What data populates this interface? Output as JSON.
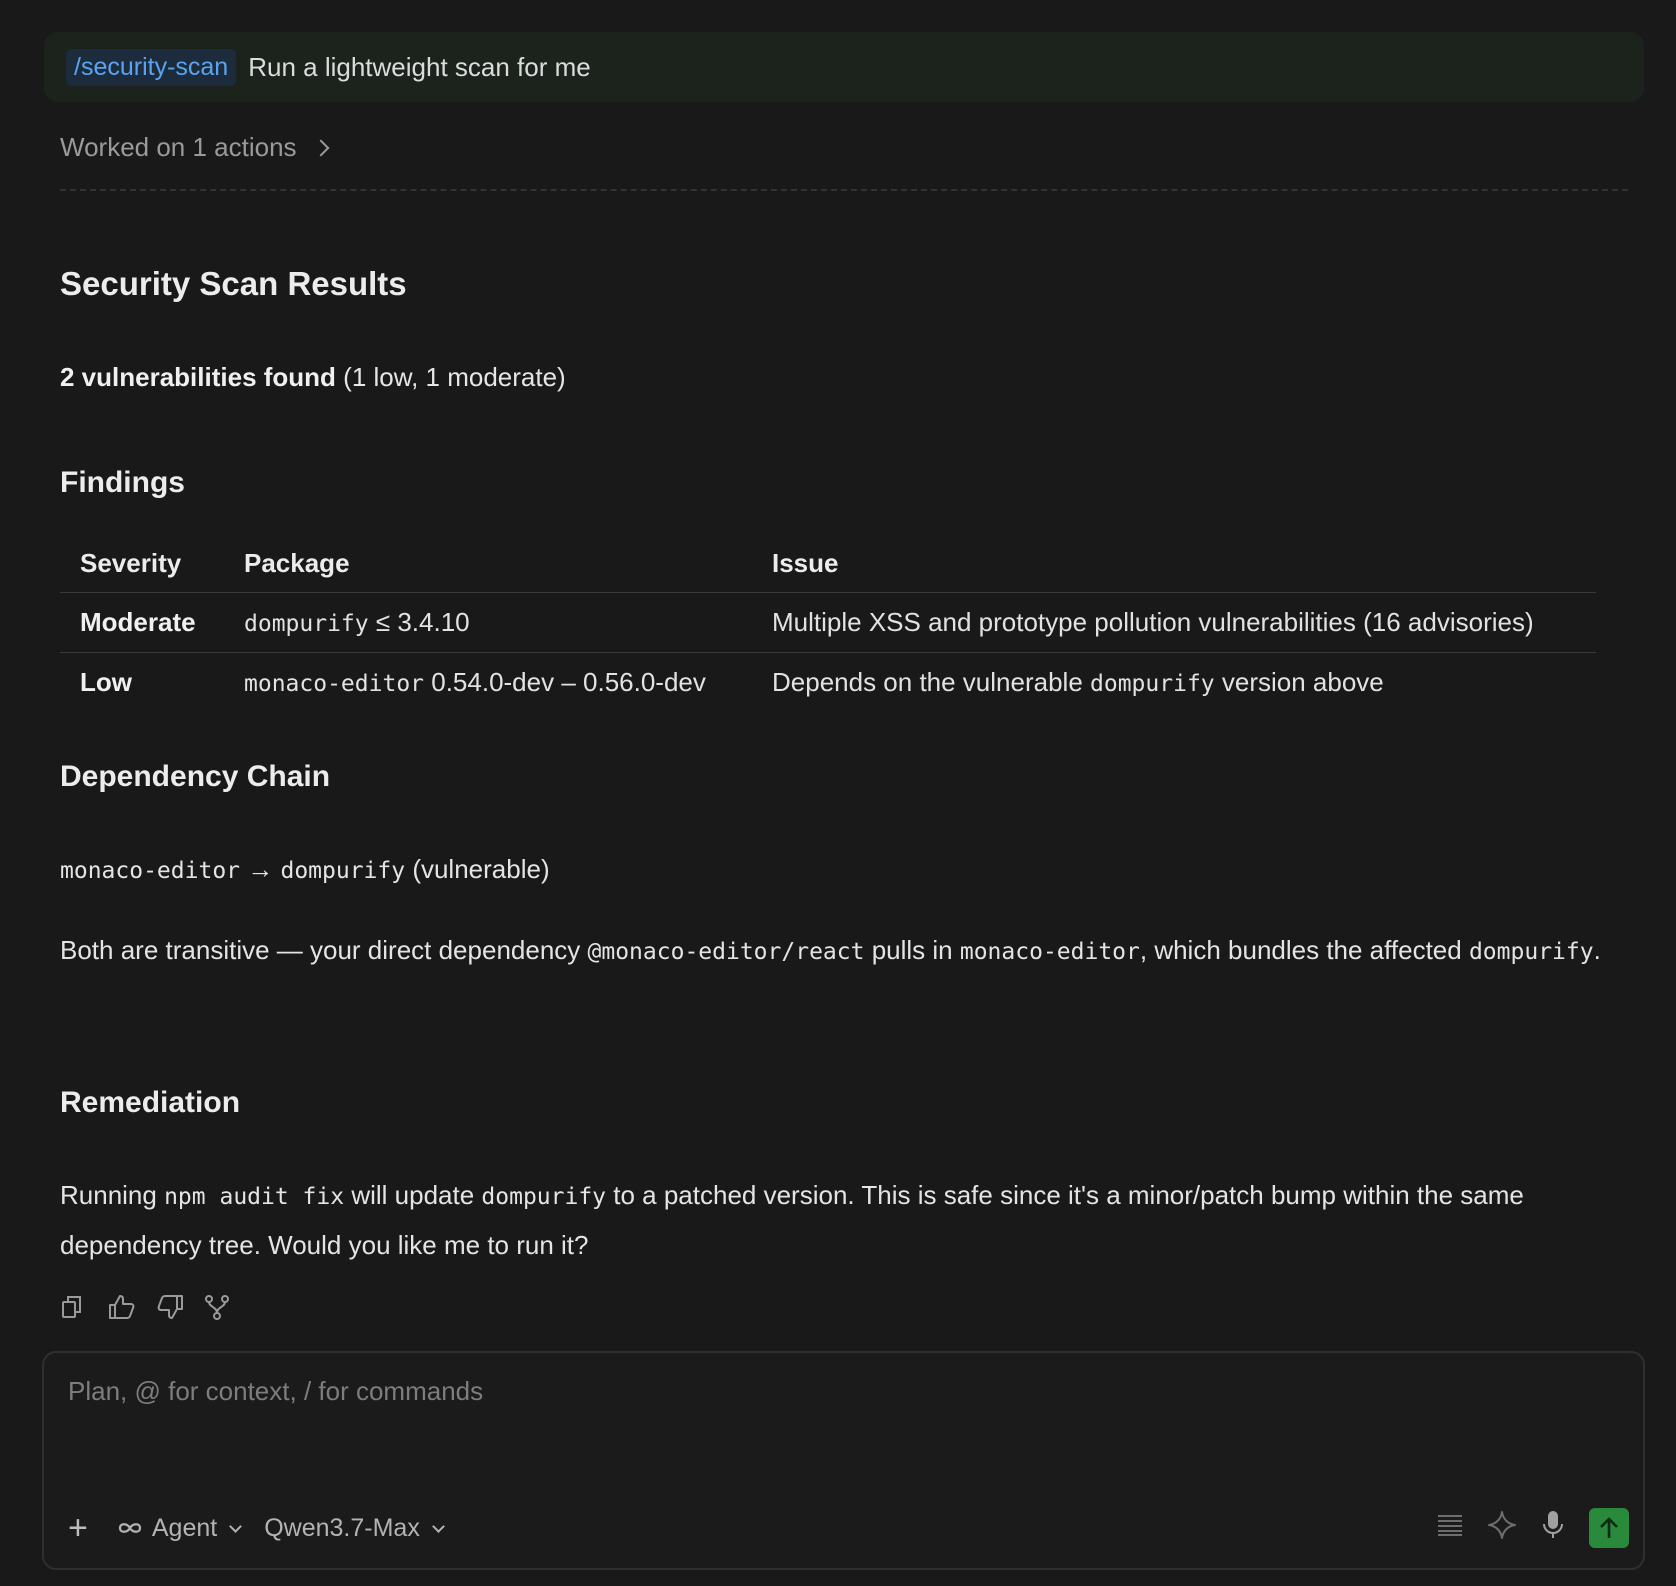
{
  "user_message": {
    "command": "/security-scan",
    "text": "Run a lightweight scan for me"
  },
  "worked_on": "Worked on 1 actions",
  "report": {
    "title": "Security Scan Results",
    "summary_bold": "2 vulnerabilities found",
    "summary_rest": " (1 low, 1 moderate)",
    "findings_heading": "Findings",
    "table": {
      "headers": [
        "Severity",
        "Package",
        "Issue"
      ],
      "rows": [
        {
          "severity": "Moderate",
          "package_code": "dompurify",
          "package_rest": " ≤ 3.4.10",
          "issue": "Multiple XSS and prototype pollution vulnerabilities (16 advisories)"
        },
        {
          "severity": "Low",
          "package_code": "monaco-editor",
          "package_rest": " 0.54.0-dev – 0.56.0-dev",
          "issue_pre": "Depends on the vulnerable ",
          "issue_code": "dompurify",
          "issue_post": " version above"
        }
      ]
    },
    "chain_heading": "Dependency Chain",
    "chain": {
      "from": "monaco-editor",
      "arrow": " → ",
      "to": "dompurify",
      "note": " (vulnerable)"
    },
    "transitive": {
      "t1": "Both are transitive — your direct dependency ",
      "c1": "@monaco-editor/react",
      "t2": " pulls in ",
      "c2": "monaco-editor",
      "t3": ", which bundles the affected ",
      "c3": "dompurify",
      "t4": "."
    },
    "remediation_heading": "Remediation",
    "remediation": {
      "t1": "Running ",
      "c1": "npm audit fix",
      "t2": " will update ",
      "c2": "dompurify",
      "t3": " to a patched version. This is safe since it's a minor/patch bump within the same dependency tree. Would you like me to run it?"
    }
  },
  "message_actions": [
    "copy-icon",
    "thumbs-up-icon",
    "thumbs-down-icon",
    "branch-icon"
  ],
  "composer": {
    "placeholder": "Plan, @ for context, / for commands",
    "mode_label": "Agent",
    "model_label": "Qwen3.7-Max"
  },
  "colors": {
    "background": "#191919",
    "command_chip": "#5aa3f0",
    "send_button": "#2a8a3c"
  }
}
